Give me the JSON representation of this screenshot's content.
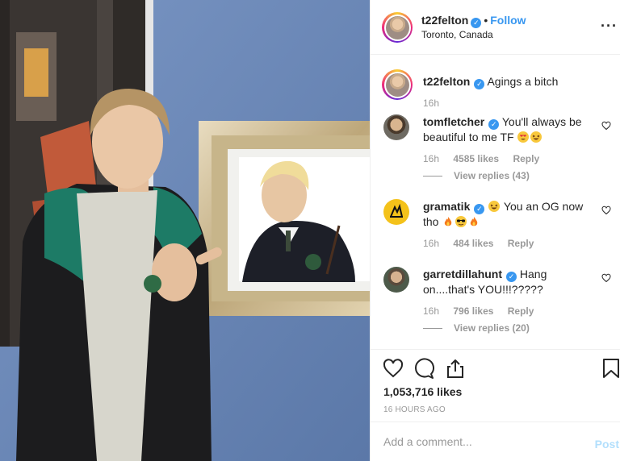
{
  "post": {
    "username": "t22felton",
    "follow_label": "Follow",
    "location": "Toronto, Canada",
    "caption": "Agings a bitch",
    "caption_time": "16h",
    "likes": "1,053,716 likes",
    "posted_ago": "16 HOURS AGO"
  },
  "comments": [
    {
      "username": "tomfletcher",
      "text": "You'll always be beautiful to me TF",
      "emojis": [
        "heart-eyes-emoji",
        "laughing-emoji"
      ],
      "time": "16h",
      "likes": "4585 likes",
      "reply_label": "Reply",
      "view_replies": "View replies (43)"
    },
    {
      "username": "gramatik",
      "text_before": "You an OG now tho",
      "emojis_inline": [
        "laughing-emoji"
      ],
      "emojis_trailing": [
        "fire-emoji",
        "sunglasses-emoji",
        "fire-emoji"
      ],
      "time": "16h",
      "likes": "484 likes",
      "reply_label": "Reply"
    },
    {
      "username": "garretdillahunt",
      "text": "Hang on....that's YOU!!!?????",
      "time": "16h",
      "likes": "796 likes",
      "reply_label": "Reply",
      "view_replies": "View replies (20)"
    }
  ],
  "comment_box": {
    "placeholder": "Add a comment...",
    "post_label": "Post"
  },
  "icons": {
    "like": "heart-icon",
    "comment": "comment-icon",
    "share": "share-icon",
    "save": "bookmark-icon",
    "more": "more-options-icon",
    "verified": "verified-badge-icon"
  },
  "colors": {
    "accent": "#3897f0",
    "muted": "#999999",
    "post_disabled": "#b2dffc",
    "wall": "#6d8ab8"
  }
}
